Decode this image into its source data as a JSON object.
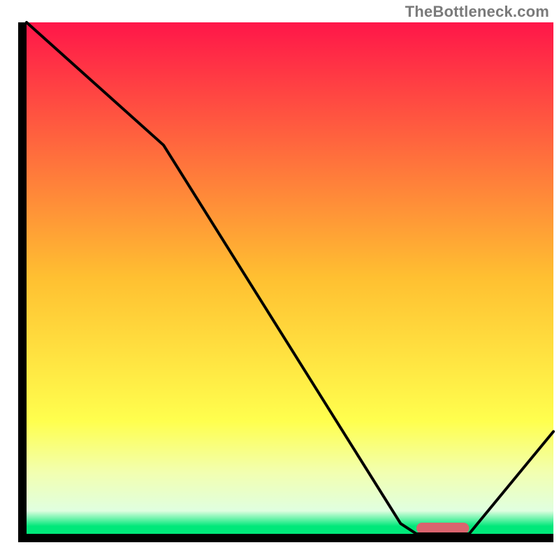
{
  "attribution": "TheBottleneck.com",
  "chart_data": {
    "type": "line",
    "title": "",
    "xlabel": "",
    "ylabel": "",
    "xlim": [
      0,
      100
    ],
    "ylim": [
      0,
      100
    ],
    "x": [
      0,
      26,
      71,
      74,
      84,
      100
    ],
    "values": [
      100,
      76,
      2,
      0,
      0,
      20
    ],
    "marker": {
      "x_start": 74,
      "x_end": 84,
      "y": 0,
      "color": "#d9646e"
    },
    "gradient_stops": [
      {
        "offset": 0.0,
        "color": "#ff1649"
      },
      {
        "offset": 0.5,
        "color": "#ffc031"
      },
      {
        "offset": 0.78,
        "color": "#ffff4e"
      },
      {
        "offset": 0.88,
        "color": "#f2ffb0"
      },
      {
        "offset": 0.955,
        "color": "#e0ffe0"
      },
      {
        "offset": 0.985,
        "color": "#00e87a"
      },
      {
        "offset": 1.0,
        "color": "#00e87a"
      }
    ],
    "axis_color": "#000000",
    "line_color": "#000000"
  }
}
